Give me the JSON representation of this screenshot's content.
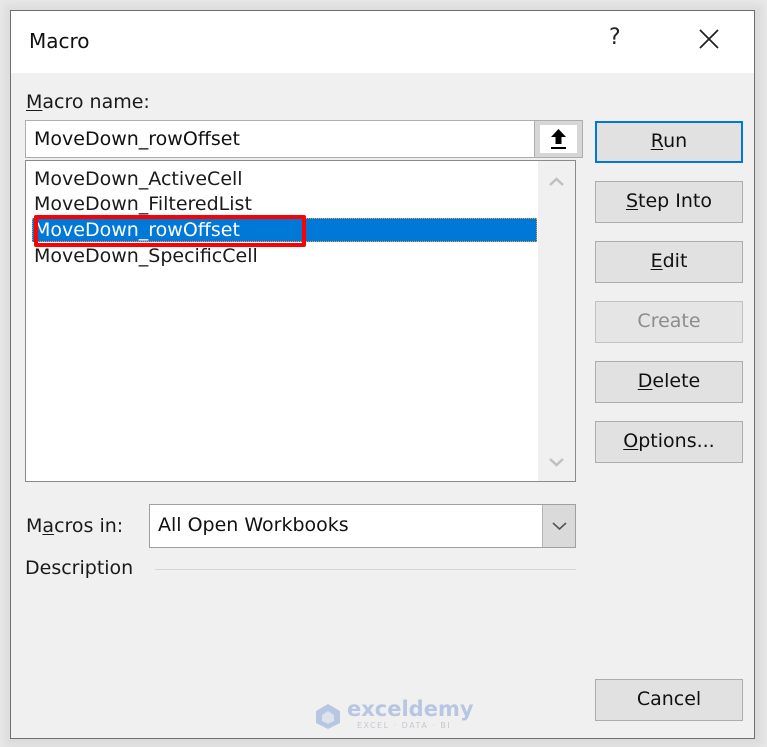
{
  "window": {
    "title": "Macro",
    "help_label": "?",
    "close_icon": "close-x-icon"
  },
  "macro_name": {
    "label_prefix": "",
    "label_accel": "M",
    "label_rest": "acro name:",
    "value": "MoveDown_rowOffset",
    "upload_icon": "upload-arrow-icon"
  },
  "macro_list": {
    "items": [
      {
        "label": "MoveDown_ActiveCell",
        "selected": false
      },
      {
        "label": "MoveDown_FilteredList",
        "selected": false
      },
      {
        "label": "MoveDown_rowOffset",
        "selected": true
      },
      {
        "label": "MoveDown_SpecificCell",
        "selected": false
      }
    ],
    "scroll_up_icon": "chevron-up-icon",
    "scroll_down_icon": "chevron-down-icon",
    "highlight_color": "#0078d7",
    "annotation_color": "#ff0000"
  },
  "buttons": {
    "run": {
      "accel": "R",
      "rest": "un",
      "enabled": true,
      "default": true
    },
    "step_into": {
      "accel": "S",
      "rest": "tep Into",
      "enabled": true
    },
    "edit": {
      "accel": "E",
      "rest": "dit",
      "enabled": true
    },
    "create": {
      "label": "Create",
      "enabled": false
    },
    "delete": {
      "accel": "D",
      "rest": "elete",
      "enabled": true
    },
    "options": {
      "accel": "O",
      "rest": "ptions...",
      "enabled": true
    },
    "cancel": {
      "label": "Cancel",
      "enabled": true
    }
  },
  "macros_in": {
    "label_pre": "M",
    "label_accel": "a",
    "label_rest": "cros in:",
    "selected": "All Open Workbooks"
  },
  "description": {
    "label": "Description"
  },
  "watermark": {
    "name": "exceldemy",
    "tagline": "EXCEL · DATA · BI"
  }
}
